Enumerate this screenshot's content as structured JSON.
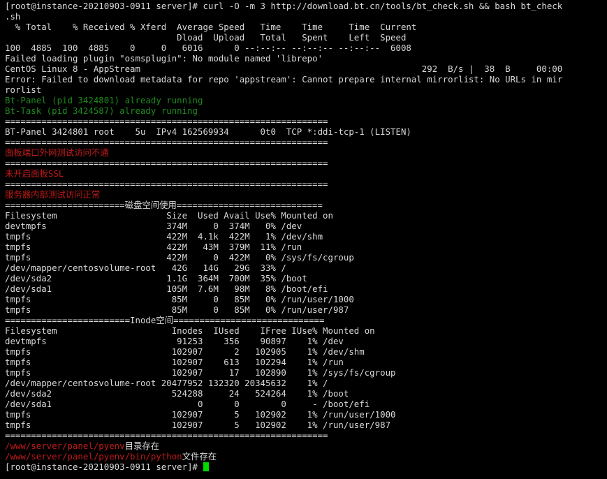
{
  "terminal": {
    "colors": {
      "background": "#000000",
      "text": "#d9d9d9",
      "success": "#1f8a1f",
      "error": "#c11a1a",
      "cursor": "#00d800"
    },
    "lines": [
      [
        {
          "t": "[root@instance-20210903-0911 server]# curl -O -m 3 http://download.bt.cn/tools/bt_check.sh && bash bt_check",
          "c": "default"
        }
      ],
      [
        {
          "t": ".sh",
          "c": "default"
        }
      ],
      [
        {
          "t": "  % Total    % Received % Xferd  Average Speed   Time    Time     Time  Current",
          "c": "default"
        }
      ],
      [
        {
          "t": "                                 Dload  Upload   Total   Spent    Left  Speed",
          "c": "default"
        }
      ],
      [
        {
          "t": "100  4885  100  4885    0     0   6016      0 --:--:-- --:--:-- --:--:--  6008",
          "c": "default"
        }
      ],
      [
        {
          "t": "Failed loading plugin \"osmsplugin\": No module named 'librepo'",
          "c": "default"
        }
      ],
      [
        {
          "t": "CentOS Linux 8 - AppStream                                                      292  B/s |  38  B     00:00",
          "c": "default"
        }
      ],
      [
        {
          "t": "Error: Failed to download metadata for repo 'appstream': Cannot prepare internal mirrorlist: No URLs in mir",
          "c": "default"
        }
      ],
      [
        {
          "t": "rorlist",
          "c": "default"
        }
      ],
      [
        {
          "t": "Bt-Panel (pid 3424801) already running",
          "c": "green"
        }
      ],
      [
        {
          "t": "Bt-Task (pid 3424587) already running",
          "c": "green"
        }
      ],
      [
        {
          "t": "==============================================================",
          "c": "default"
        }
      ],
      [
        {
          "t": "BT-Panel 3424801 root    5u  IPv4 162569934      0t0  TCP *:ddi-tcp-1 (LISTEN)",
          "c": "default"
        }
      ],
      [
        {
          "t": "==============================================================",
          "c": "default"
        }
      ],
      [
        {
          "t": "面板端口外网测试访问不通",
          "c": "red"
        }
      ],
      [
        {
          "t": "==============================================================",
          "c": "default"
        }
      ],
      [
        {
          "t": "未开启面板SSL",
          "c": "red"
        }
      ],
      [
        {
          "t": "==============================================================",
          "c": "default"
        }
      ],
      [
        {
          "t": "服务器内部测试访问正常",
          "c": "red"
        }
      ],
      [
        {
          "t": "=======================磁盘空间使用============================",
          "c": "default"
        }
      ],
      [
        {
          "t": "Filesystem                     Size  Used Avail Use% Mounted on",
          "c": "default"
        }
      ],
      [
        {
          "t": "devtmpfs                       374M     0  374M   0% /dev",
          "c": "default"
        }
      ],
      [
        {
          "t": "tmpfs                          422M  4.1k  422M   1% /dev/shm",
          "c": "default"
        }
      ],
      [
        {
          "t": "tmpfs                          422M   43M  379M  11% /run",
          "c": "default"
        }
      ],
      [
        {
          "t": "tmpfs                          422M     0  422M   0% /sys/fs/cgroup",
          "c": "default"
        }
      ],
      [
        {
          "t": "/dev/mapper/centosvolume-root   42G   14G   29G  33% /",
          "c": "default"
        }
      ],
      [
        {
          "t": "/dev/sda2                      1.1G  364M  700M  35% /boot",
          "c": "default"
        }
      ],
      [
        {
          "t": "/dev/sda1                      105M  7.6M   98M   8% /boot/efi",
          "c": "default"
        }
      ],
      [
        {
          "t": "tmpfs                           85M     0   85M   0% /run/user/1000",
          "c": "default"
        }
      ],
      [
        {
          "t": "tmpfs                           85M     0   85M   0% /run/user/987",
          "c": "default"
        }
      ],
      [
        {
          "t": "========================Inode空间=============================",
          "c": "default"
        }
      ],
      [
        {
          "t": "Filesystem                      Inodes  IUsed    IFree IUse% Mounted on",
          "c": "default"
        }
      ],
      [
        {
          "t": "devtmpfs                         91253    356    90897    1% /dev",
          "c": "default"
        }
      ],
      [
        {
          "t": "tmpfs                           102907      2   102905    1% /dev/shm",
          "c": "default"
        }
      ],
      [
        {
          "t": "tmpfs                           102907    613   102294    1% /run",
          "c": "default"
        }
      ],
      [
        {
          "t": "tmpfs                           102907     17   102890    1% /sys/fs/cgroup",
          "c": "default"
        }
      ],
      [
        {
          "t": "/dev/mapper/centosvolume-root 20477952 132320 20345632    1% /",
          "c": "default"
        }
      ],
      [
        {
          "t": "/dev/sda2                       524288     24   524264    1% /boot",
          "c": "default"
        }
      ],
      [
        {
          "t": "/dev/sda1                            0      0        0     - /boot/efi",
          "c": "default"
        }
      ],
      [
        {
          "t": "tmpfs                           102907      5   102902    1% /run/user/1000",
          "c": "default"
        }
      ],
      [
        {
          "t": "tmpfs                           102907      5   102902    1% /run/user/987",
          "c": "default"
        }
      ],
      [
        {
          "t": "==============================================================",
          "c": "default"
        }
      ],
      [
        {
          "t": "/www/server/panel/pyenv",
          "c": "red"
        },
        {
          "t": "目录存在",
          "c": "default"
        }
      ],
      [
        {
          "t": "/www/server/panel/pyenv/bin/python",
          "c": "red"
        },
        {
          "t": "文件存在",
          "c": "default"
        }
      ],
      [
        {
          "t": "[root@instance-20210903-0911 server]# ",
          "c": "default"
        }
      ]
    ]
  }
}
